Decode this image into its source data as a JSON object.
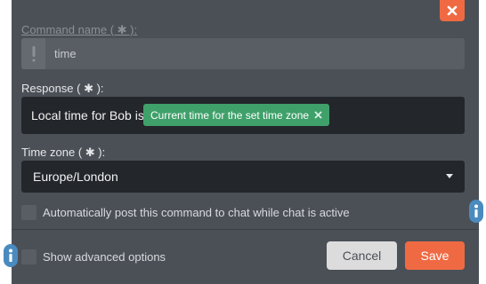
{
  "form": {
    "command_name": {
      "label": "Command name ( ✱ ):",
      "value": "time",
      "icon": "exclamation-icon"
    },
    "response": {
      "label": "Response ( ✱ ):",
      "text": "Local time for Bob is",
      "variable_tag": {
        "label": "Current time for the set time zone",
        "remove_icon": "close-icon"
      }
    },
    "time_zone": {
      "label": "Time zone ( ✱ ):",
      "selected": "Europe/London"
    },
    "auto_post": {
      "label": "Automatically post this command to chat while chat is active",
      "checked": false
    }
  },
  "footer": {
    "advanced_options": {
      "label": "Show advanced options",
      "checked": false
    },
    "cancel_label": "Cancel",
    "save_label": "Save"
  },
  "colors": {
    "panel": "#4b5057",
    "input_dark": "#23262b",
    "accent_orange": "#ef6a43",
    "tag_green": "#3fa06a",
    "info_blue": "#4a8bbf"
  }
}
